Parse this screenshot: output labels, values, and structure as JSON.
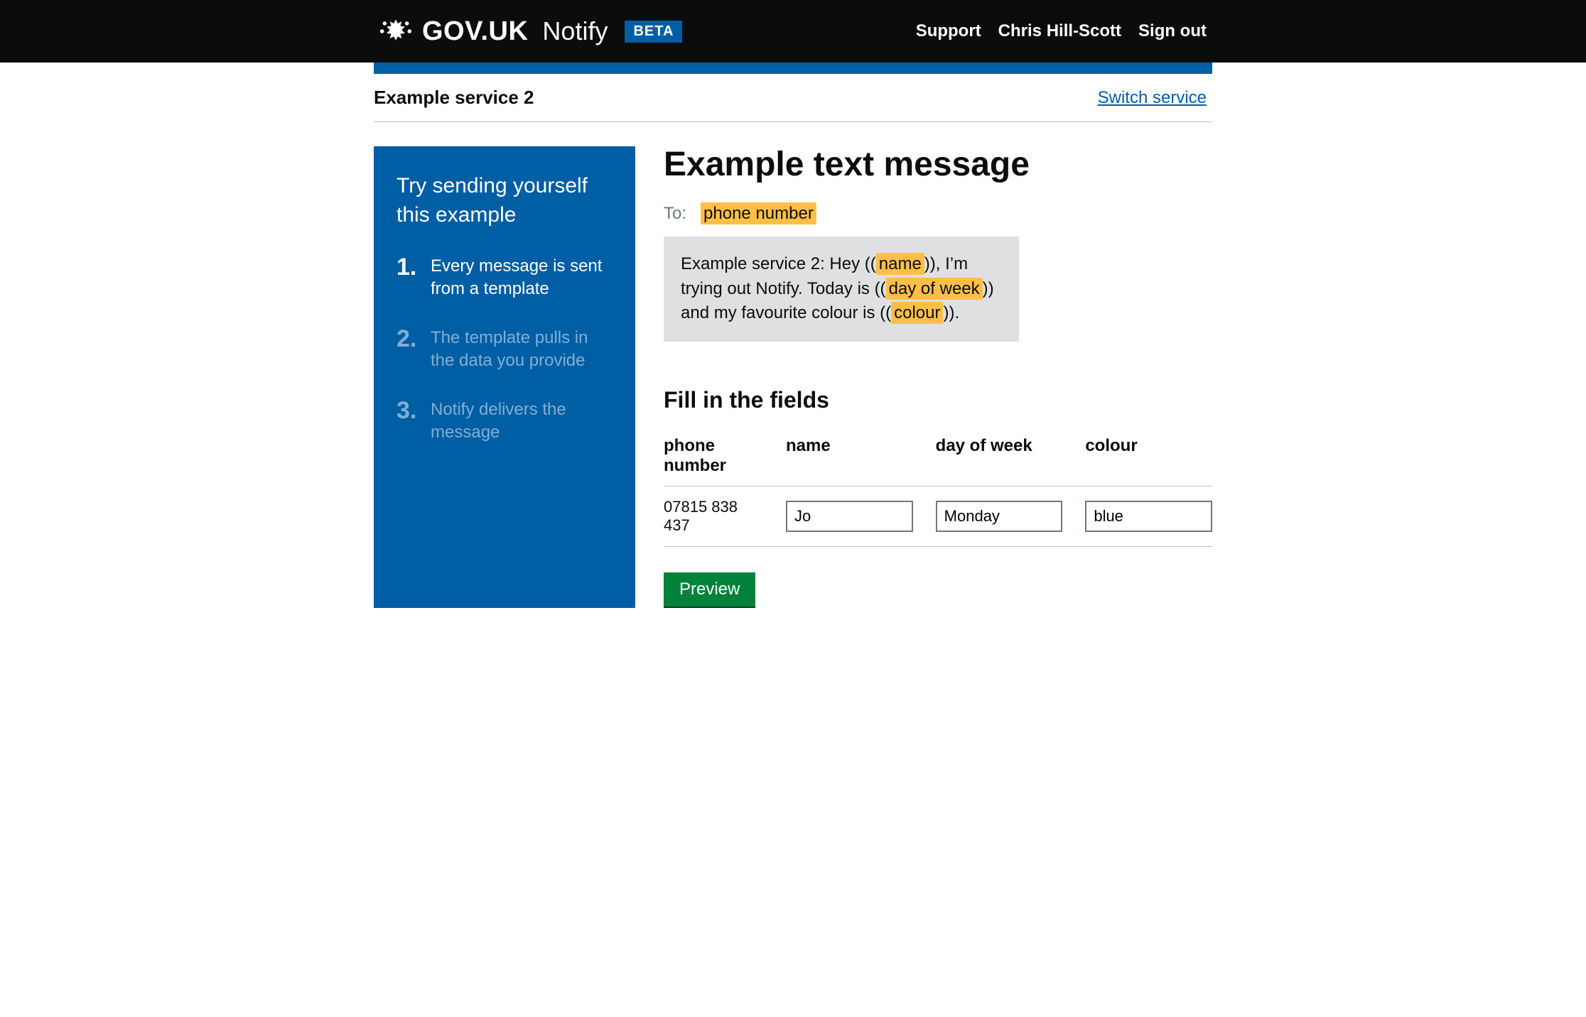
{
  "header": {
    "brand": "GOV.UK",
    "product": "Notify",
    "beta": "BETA",
    "links": {
      "support": "Support",
      "user": "Chris Hill-Scott",
      "signout": "Sign out"
    }
  },
  "service": {
    "name": "Example service 2",
    "switch": "Switch service"
  },
  "sidebar": {
    "heading": "Try sending yourself this example",
    "steps": [
      {
        "number": "1.",
        "text": "Every message is sent from a template",
        "active": true
      },
      {
        "number": "2.",
        "text": "The template pulls in the data you provide",
        "active": false
      },
      {
        "number": "3.",
        "text": "Notify delivers the message",
        "active": false
      }
    ]
  },
  "content": {
    "title": "Example text message",
    "to_label": "To:",
    "to_placeholder": "phone number",
    "message": {
      "prefix": "Example service 2: Hey ((",
      "ph1": "name",
      "part2": ")), I’m trying out Notify. Today is ((",
      "ph2": "day of week",
      "part3": ")) and my favourite colour is ((",
      "ph3": "colour",
      "part4": "))."
    },
    "fill_heading": "Fill in the fields",
    "columns": {
      "phone": "phone number",
      "name": "name",
      "day": "day of week",
      "colour": "colour"
    },
    "row": {
      "phone": "07815 838 437",
      "name": "Jo",
      "day": "Monday",
      "colour": "blue"
    },
    "preview_btn": "Preview"
  }
}
